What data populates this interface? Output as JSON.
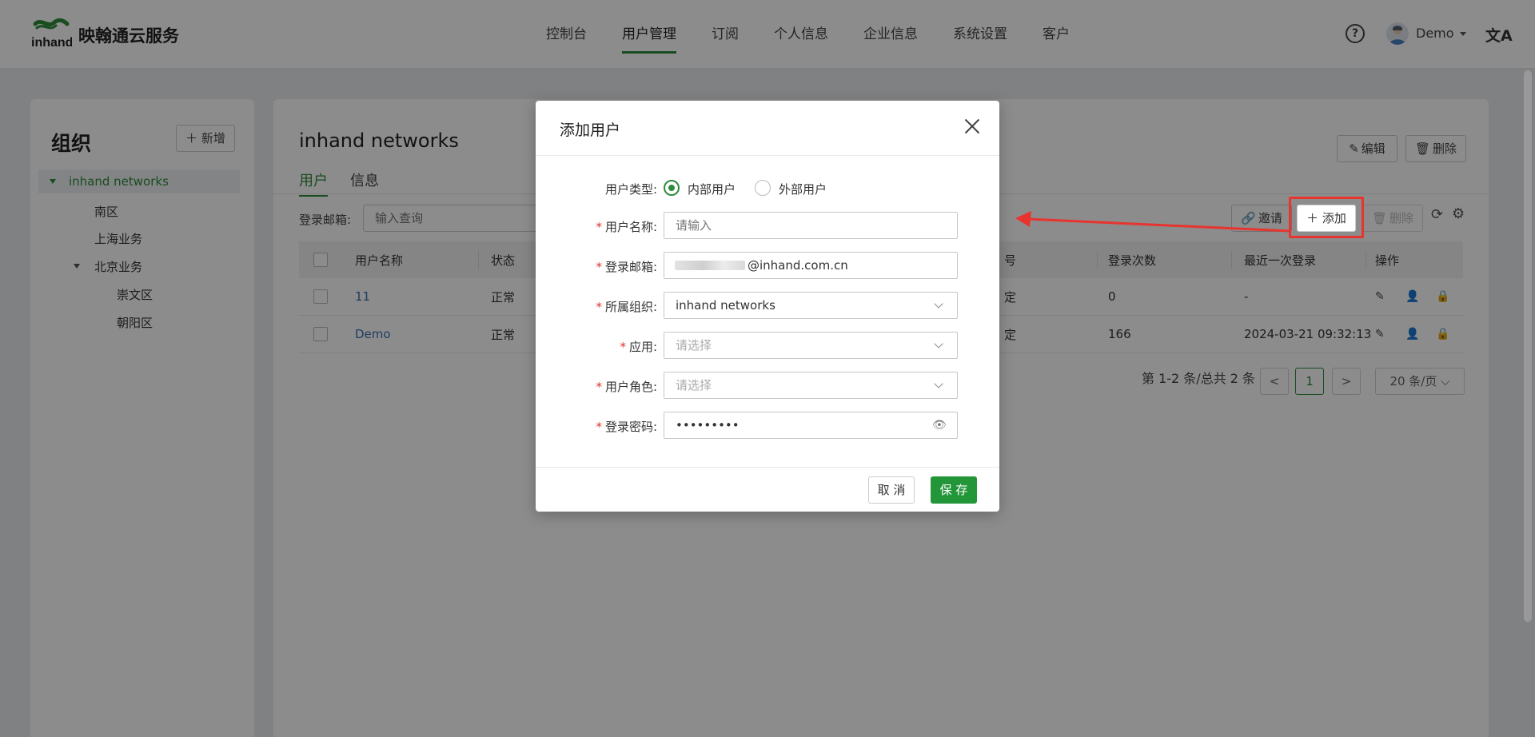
{
  "app": {
    "brand": "映翰通云服务",
    "logo_text": "inhand",
    "nav": [
      "控制台",
      "用户管理",
      "订阅",
      "个人信息",
      "企业信息",
      "系统设置",
      "客户"
    ],
    "active_nav": "用户管理",
    "help_icon": "?",
    "username": "Demo",
    "lang_icon": "文A"
  },
  "org_panel": {
    "title": "组织",
    "add_label": "新增",
    "tree": {
      "root": "inhand networks",
      "children": [
        "南区",
        "上海业务",
        "北京业务"
      ],
      "beijing_children": [
        "崇文区",
        "朝阳区"
      ]
    }
  },
  "main": {
    "title": "inhand networks",
    "tabs": [
      "用户",
      "信息"
    ],
    "edit_label": "编辑",
    "delete_label": "删除",
    "filter_label": "登录邮箱:",
    "filter_placeholder": "输入查询",
    "invite_label": "邀请",
    "add_label": "添加",
    "bulk_delete_label": "删除",
    "columns": [
      "用户名称",
      "状态",
      "登录次数",
      "最近一次登录",
      "操作"
    ],
    "partial_col": "号",
    "rows": [
      {
        "name": "11",
        "status": "正常",
        "partial": "定",
        "logins": "0",
        "last_login": "-"
      },
      {
        "name": "Demo",
        "status": "正常",
        "partial": "定",
        "logins": "166",
        "last_login": "2024-03-21 09:32:13"
      }
    ],
    "pagination": {
      "summary": "第 1-2 条/总共 2 条",
      "prev": "<",
      "current": "1",
      "next": ">",
      "page_size": "20 条/页"
    }
  },
  "dialog": {
    "title": "添加用户",
    "user_type_label": "用户类型:",
    "user_type_options": [
      "内部用户",
      "外部用户"
    ],
    "selected_user_type": "内部用户",
    "name_label": "用户名称:",
    "name_placeholder": "请输入",
    "email_label": "登录邮箱:",
    "email_value": "@inhand.com.cn",
    "org_label": "所属组织:",
    "org_value": "inhand networks",
    "app_label": "应用:",
    "app_placeholder": "请选择",
    "role_label": "用户角色:",
    "role_placeholder": "请选择",
    "password_label": "登录密码:",
    "password_value": "•••••••••",
    "cancel_label": "取 消",
    "save_label": "保 存"
  },
  "colors": {
    "accent": "#2e8b3a",
    "save": "#23963a",
    "annotation": "#e8342f",
    "link": "#3a6fb0"
  }
}
